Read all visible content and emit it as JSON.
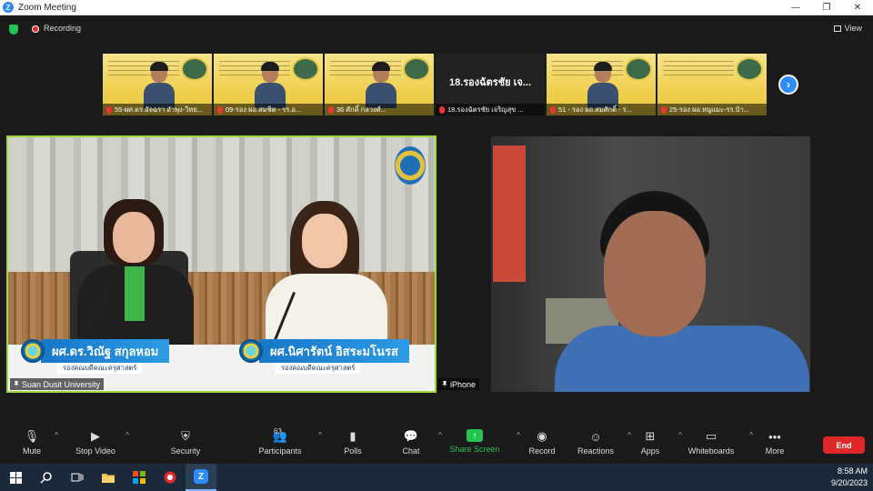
{
  "window": {
    "title": "Zoom Meeting",
    "minimize": "—",
    "restore": "❐",
    "close": "✕"
  },
  "meeting": {
    "recording_label": "Recording",
    "view_label": "View",
    "next_page": "›"
  },
  "thumbnails": [
    {
      "name": "55-ผศ.ดร.อัจฉรา อำพุง-วิทย...",
      "type": "slide"
    },
    {
      "name": "09-รอง ผอ.สมชิต - รร.อ...",
      "type": "slide"
    },
    {
      "name": "36 ศักดิ์ กลวงศ์...",
      "type": "slide"
    },
    {
      "name": "18.รองฉัตรชัย เจริญสุข ...",
      "type": "dark",
      "big_text": "18.รองฉัตรชัย เจ..."
    },
    {
      "name": "51 - รอง ผอ.สมศักดิ์ - ร...",
      "type": "slide"
    },
    {
      "name": "25-รอง ผอ.หนูแมะ-รร.บ้า...",
      "type": "slide"
    }
  ],
  "main_video": {
    "label": "Suan Dusit University",
    "speaker1_name": "ผศ.ดร.วิณัฐ สกุลหอม",
    "speaker1_title": "รองคณบดีคณะครุศาสตร์",
    "speaker2_name": "ผศ.นิศารัตน์ อิสระมโนรส",
    "speaker2_title": "รองคณบดีคณะครุศาสตร์"
  },
  "side_video": {
    "label": "iPhone"
  },
  "toolbar": {
    "mute": "Mute",
    "stop_video": "Stop Video",
    "security": "Security",
    "participants": "Participants",
    "participants_count": "63",
    "polls": "Polls",
    "chat": "Chat",
    "share_screen": "Share Screen",
    "record": "Record",
    "reactions": "Reactions",
    "apps": "Apps",
    "whiteboards": "Whiteboards",
    "more": "More",
    "end": "End"
  },
  "taskbar": {
    "time": "8:58 AM",
    "date": "9/20/2023"
  },
  "colors": {
    "zoom_blue": "#2d8cff",
    "active_speaker": "#9ed83e",
    "share_green": "#23c552",
    "end_red": "#e02828"
  }
}
